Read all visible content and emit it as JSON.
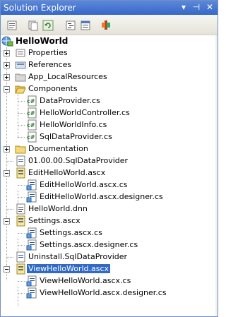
{
  "window": {
    "title": "Solution Explorer",
    "controls": {
      "dropdown": "▾",
      "pin": "⊣",
      "close": "✕"
    }
  },
  "toolbar": {
    "buttons": [
      "properties-icon",
      "show-all-files-icon",
      "refresh-icon",
      "view-code-icon",
      "view-designer-icon",
      "class-diagram-icon"
    ]
  },
  "tree": {
    "root": "HelloWorld",
    "properties": "Properties",
    "references": "References",
    "app_local_resources": "App_LocalResources",
    "components": "Components",
    "data_provider": "DataProvider.cs",
    "hello_world_controller": "HelloWorldController.cs",
    "hello_world_info": "HelloWorldInfo.cs",
    "sql_data_provider": "SqlDataProvider.cs",
    "documentation": "Documentation",
    "sql_data_provider_file": "01.00.00.SqlDataProvider",
    "edit_hello_world": "EditHelloWorld.ascx",
    "edit_hello_world_cs": "EditHelloWorld.ascx.cs",
    "edit_hello_world_designer": "EditHelloWorld.ascx.designer.cs",
    "hello_world_dnn": "HelloWorld.dnn",
    "settings": "Settings.ascx",
    "settings_cs": "Settings.ascx.cs",
    "settings_designer": "Settings.ascx.designer.cs",
    "uninstall": "Uninstall.SqlDataProvider",
    "view_hello_world": "ViewHelloWorld.ascx",
    "view_hello_world_cs": "ViewHelloWorld.ascx.cs",
    "view_hello_world_designer": "ViewHelloWorld.ascx.designer.cs",
    "selected_item": "ViewHelloWorld.ascx"
  },
  "colors": {
    "title_bar": "#3768c9",
    "selection": "#316ac5"
  }
}
